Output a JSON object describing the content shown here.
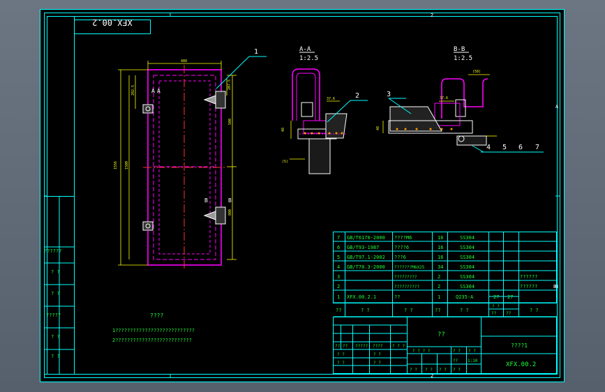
{
  "colors": {
    "background": "#000000",
    "frame": "#00ffff",
    "outline": "#ff00ff",
    "text": "#00ff00",
    "dimension": "#ffff00",
    "viewport": "#5b6470"
  },
  "title_stamp": "XFX.00.2",
  "border": {
    "top_zone": "2",
    "bottom_zone": "2",
    "right_zone_top": "A",
    "right_zone_bottom": "B"
  },
  "balloons": [
    "1",
    "2",
    "3",
    "4",
    "5",
    "6",
    "7"
  ],
  "section_aa": {
    "label": "A-A",
    "scale": "1:2.5",
    "cut_left": "A",
    "cut_right": "A"
  },
  "section_bb": {
    "label": "B-B",
    "scale": "1:2.5",
    "cut_left": "B",
    "cut_right": "B"
  },
  "dimensions": {
    "width": "480",
    "height": "1556",
    "middle": "1500",
    "upper": "500",
    "lower": "800",
    "top_left": "202.5",
    "top_right": "207.5",
    "aa_top": "37.6",
    "aa_left": "48",
    "aa_bottom": "(5)",
    "bb_top": "(58)",
    "bb_mid": "37.6",
    "bb_left": "48"
  },
  "left_column": [
    "??????",
    "? ?",
    "? ?",
    "?????",
    "? ?",
    "? ?"
  ],
  "notes": {
    "title": "????",
    "line1": "1???????????????????????????",
    "line2": "2??????????????????????????"
  },
  "parts_list": [
    {
      "no": "7",
      "code": "GB/T6170-2000",
      "name": "????M6",
      "qty": "16",
      "material": "SS304",
      "w1": "",
      "w2": "",
      "remark": ""
    },
    {
      "no": "6",
      "code": "GB/T93-1987",
      "name": "????6",
      "qty": "16",
      "material": "SS304",
      "w1": "",
      "w2": "",
      "remark": ""
    },
    {
      "no": "5",
      "code": "GB/T97.1-2002",
      "name": "???6",
      "qty": "16",
      "material": "SS304",
      "w1": "",
      "w2": "",
      "remark": ""
    },
    {
      "no": "4",
      "code": "GB/T70.3-2000",
      "name": "???????M6X25",
      "qty": "34",
      "material": "SS304",
      "w1": "",
      "w2": "",
      "remark": ""
    },
    {
      "no": "3",
      "code": "",
      "name": "?????????",
      "qty": "2",
      "material": "SS304",
      "w1": "",
      "w2": "",
      "remark": "??????"
    },
    {
      "no": "2",
      "code": "",
      "name": "??????????",
      "qty": "2",
      "material": "SS304",
      "w1": "",
      "w2": "",
      "remark": "??????"
    },
    {
      "no": "1",
      "code": "XFX.00.2.1",
      "name": "??",
      "qty": "1",
      "material": "Q235-A",
      "w1": "27",
      "w2": "27",
      "remark": ""
    }
  ],
  "parts_header": {
    "no": "??",
    "code": "? ?",
    "name": "? ?",
    "qty": "??",
    "material": "? ?",
    "w_top": "? ?",
    "w1": "??",
    "w2": "??",
    "remark": "? ?"
  },
  "title_block": {
    "main_name": "??",
    "company": "????1",
    "drawing_no": "XFX.00.2",
    "rev_labels": [
      "?? ??",
      "?????",
      "????",
      "? ? ?"
    ],
    "signers": [
      "? ?",
      "? ?",
      "? ?",
      "? ?"
    ],
    "stage_row": [
      "? ? ? ?",
      "? ?",
      "? ?"
    ],
    "scale_value": "1:10",
    "sheet_row": [
      "? ?",
      "? ?",
      "? ?",
      "? ?"
    ],
    "weight_label": "??"
  },
  "side_mark": "B"
}
